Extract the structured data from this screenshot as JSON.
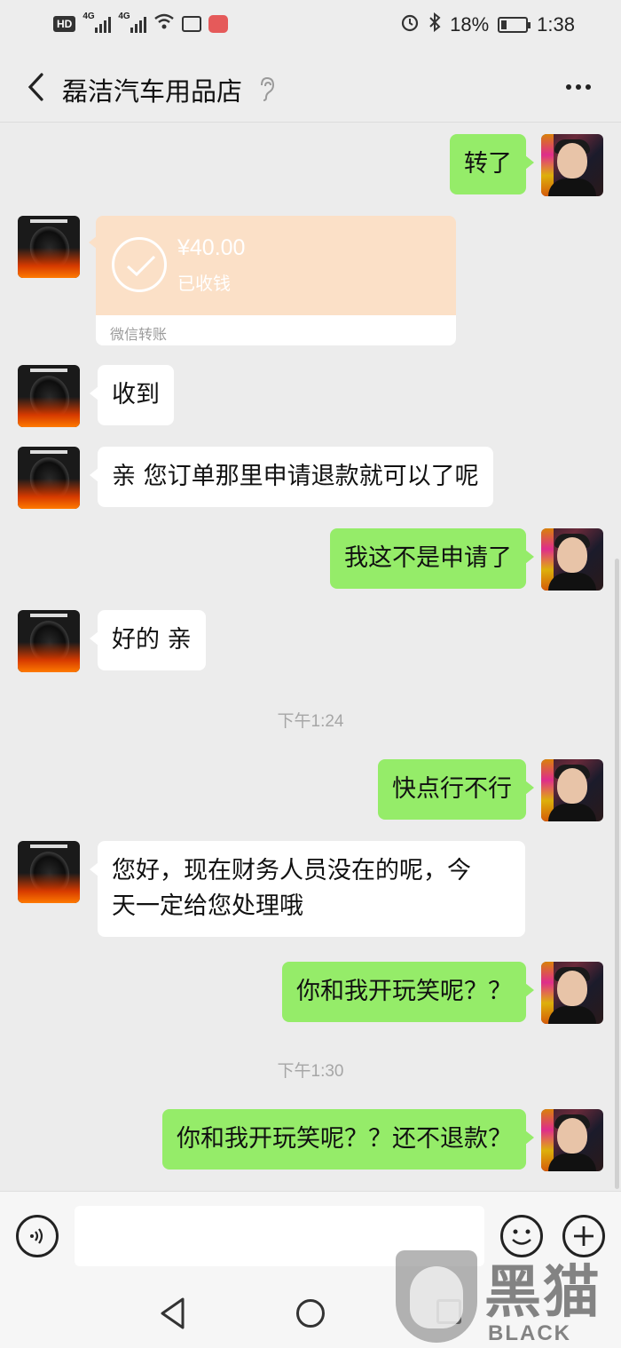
{
  "status_bar": {
    "hd_label": "HD",
    "net1": "4G",
    "net2": "4G",
    "battery_percent": "18%",
    "time": "1:38"
  },
  "header": {
    "title": "磊洁汽车用品店"
  },
  "messages": [
    {
      "sender": "me",
      "text": "转了"
    },
    {
      "sender": "them",
      "type": "transfer",
      "amount": "¥40.00",
      "status": "已收钱",
      "label": "微信转账"
    },
    {
      "sender": "them",
      "text": "收到"
    },
    {
      "sender": "them",
      "text": "亲 您订单那里申请退款就可以了呢"
    },
    {
      "sender": "me",
      "text": "我这不是申请了"
    },
    {
      "sender": "them",
      "text": "好的 亲"
    },
    {
      "type": "time",
      "text": "下午1:24"
    },
    {
      "sender": "me",
      "text": "快点行不行"
    },
    {
      "sender": "them",
      "line1": "您好，现在财务人员没在的呢，今",
      "line2": "天一定给您处理哦"
    },
    {
      "sender": "me",
      "text": "你和我开玩笑呢？？"
    },
    {
      "type": "time",
      "text": "下午1:30"
    },
    {
      "sender": "me",
      "text": "你和我开玩笑呢？？还不退款？"
    }
  ],
  "input_bar": {
    "placeholder": ""
  },
  "watermark": {
    "cn": "黑猫",
    "en": "BLACK CAT"
  },
  "colors": {
    "my_bubble": "#95ec69",
    "their_bubble": "#ffffff",
    "transfer_bg": "#fbe0c7",
    "background": "#ececec"
  }
}
